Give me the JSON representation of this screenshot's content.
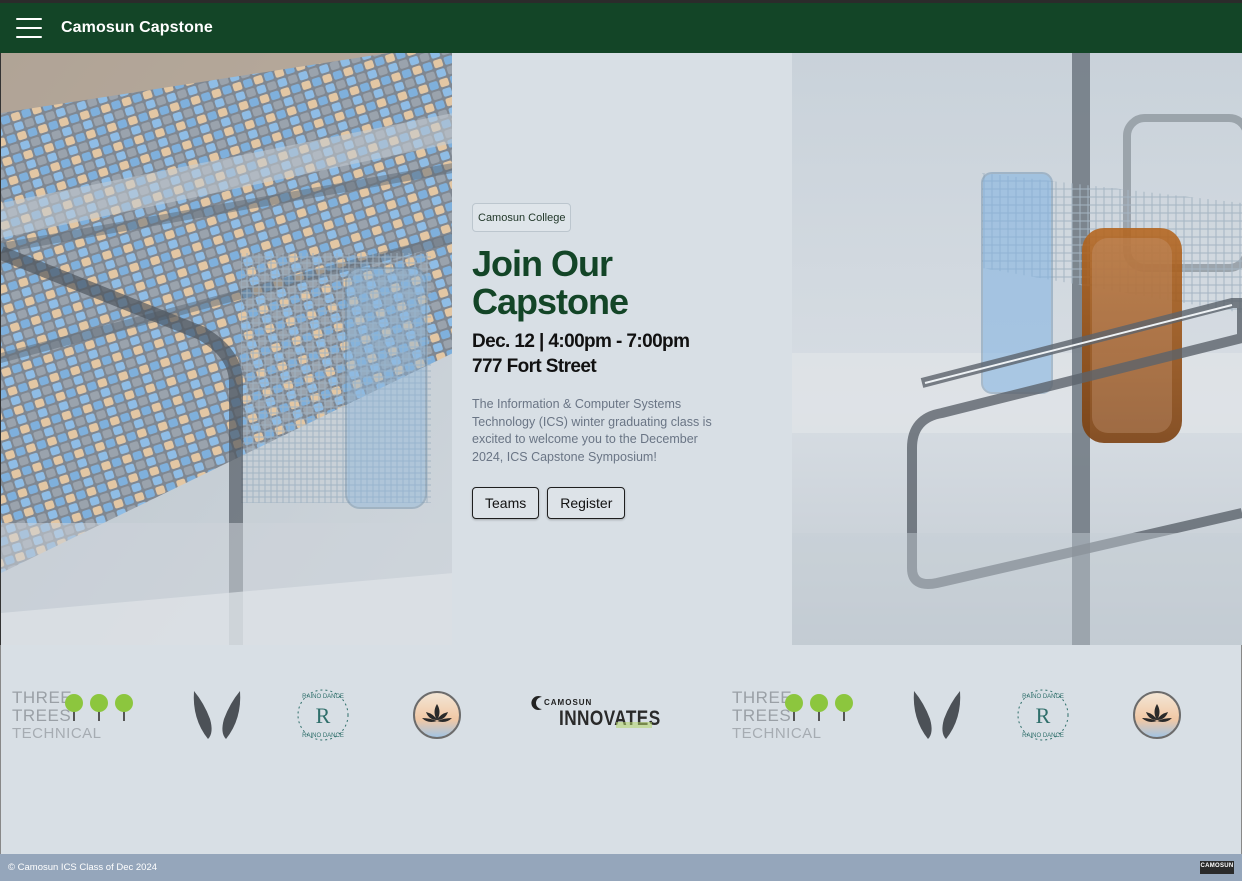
{
  "navbar": {
    "menu_icon": "hamburger-menu-icon",
    "brand": "Camosun Capstone",
    "background": "#134527"
  },
  "hero": {
    "badge": "Camosun College",
    "headline_line1": "Join Our",
    "headline_line2": "Capstone",
    "date_time": "Dec. 12 | 4:00pm - 7:00pm",
    "address": "777 Fort Street",
    "description": "The Information & Computer Systems Technology (ICS) winter graduating class is excited to welcome you to the December 2024, ICS Capstone Symposium!",
    "buttons": {
      "teams": "Teams",
      "register": "Register"
    },
    "headline_color": "#134527"
  },
  "sponsors": {
    "three_trees": {
      "line1": "THREE",
      "line2": "TREES",
      "line3": "TECHNICAL"
    },
    "raino_dance": {
      "text": "RAINO DANCE",
      "monogram": "R"
    },
    "camosun_innovates": {
      "top": "CAMOSUN",
      "bottom": "INNOVATES"
    },
    "icons": [
      "three-trees-technical-logo",
      "v-wings-logo",
      "raino-dance-logo",
      "lotus-circle-logo",
      "camosun-innovates-logo"
    ]
  },
  "footer": {
    "copyright": "© Camosun ICS Class of Dec 2024",
    "mini_logo": "CAMOSUN",
    "background": "#95a6bb"
  }
}
